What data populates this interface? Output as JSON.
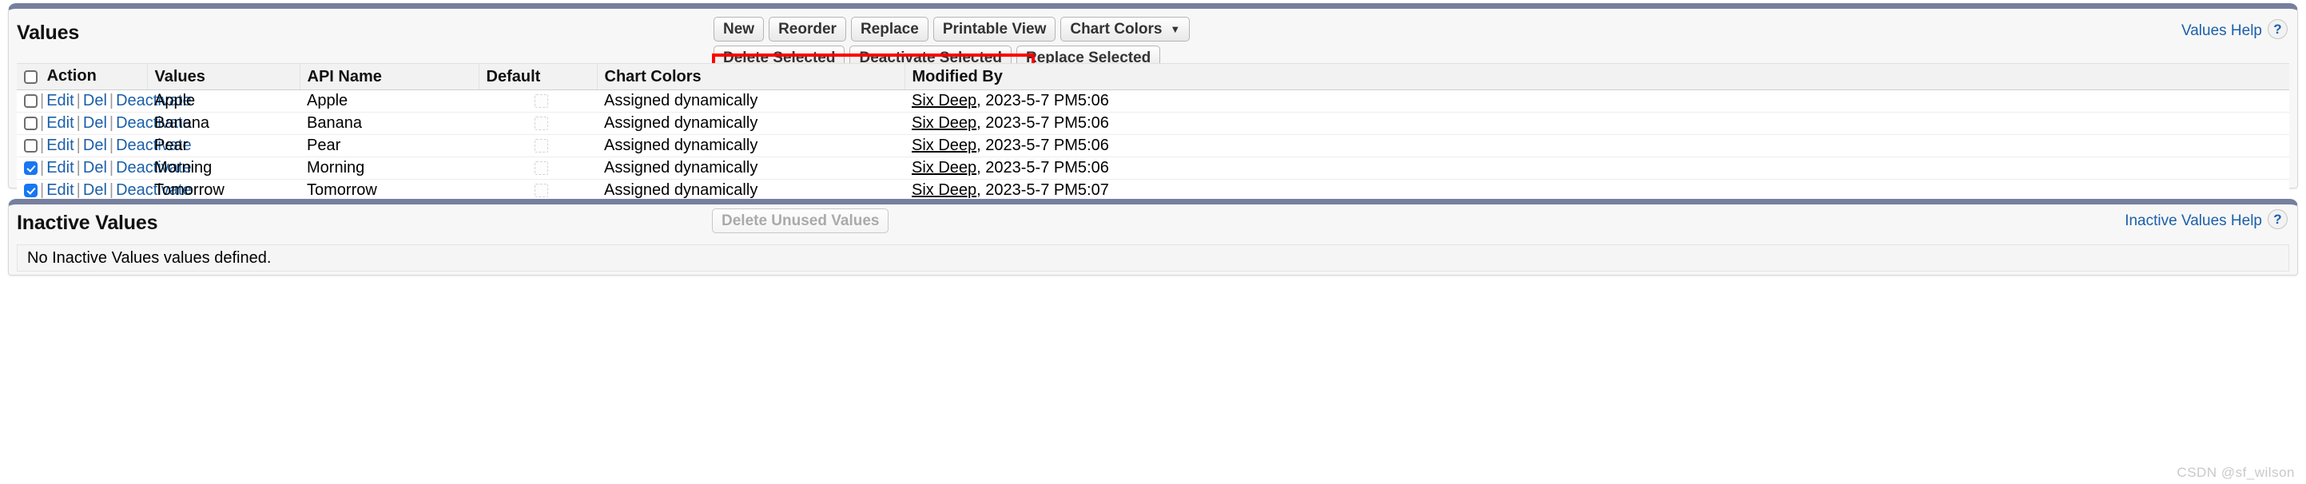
{
  "values_panel": {
    "title": "Values",
    "help_link": "Values Help",
    "help_icon": "?",
    "toolbar_row1": [
      {
        "label": "New",
        "name": "new-button",
        "disabled": false,
        "caret": false
      },
      {
        "label": "Reorder",
        "name": "reorder-button",
        "disabled": false,
        "caret": false
      },
      {
        "label": "Replace",
        "name": "replace-button",
        "disabled": false,
        "caret": false
      },
      {
        "label": "Printable View",
        "name": "printable-view-button",
        "disabled": false,
        "caret": false
      },
      {
        "label": "Chart Colors",
        "name": "chart-colors-dropdown",
        "disabled": false,
        "caret": true
      }
    ],
    "toolbar_row2": [
      {
        "label": "Delete Selected",
        "name": "delete-selected-button",
        "disabled": false,
        "caret": false
      },
      {
        "label": "Deactivate Selected",
        "name": "deactivate-selected-button",
        "disabled": false,
        "caret": false
      },
      {
        "label": "Replace Selected",
        "name": "replace-selected-button",
        "disabled": false,
        "caret": false
      }
    ],
    "caret_glyph": "▼",
    "highlight_color": "#ff0000",
    "columns": [
      "Action",
      "Values",
      "API Name",
      "Default",
      "Chart Colors",
      "Modified By"
    ],
    "row_actions": {
      "edit": "Edit",
      "del": "Del",
      "deactivate": "Deactivate",
      "separator": "|"
    },
    "rows": [
      {
        "selected": false,
        "value": "Apple",
        "api_name": "Apple",
        "default_checked": false,
        "chart_color": "Assigned dynamically",
        "modified_by_user": "Six Deep",
        "modified_at": ", 2023-5-7 PM5:06"
      },
      {
        "selected": false,
        "value": "Banana",
        "api_name": "Banana",
        "default_checked": false,
        "chart_color": "Assigned dynamically",
        "modified_by_user": "Six Deep",
        "modified_at": ", 2023-5-7 PM5:06"
      },
      {
        "selected": false,
        "value": "Pear",
        "api_name": "Pear",
        "default_checked": false,
        "chart_color": "Assigned dynamically",
        "modified_by_user": "Six Deep",
        "modified_at": ", 2023-5-7 PM5:06"
      },
      {
        "selected": true,
        "value": "Morning",
        "api_name": "Morning",
        "default_checked": false,
        "chart_color": "Assigned dynamically",
        "modified_by_user": "Six Deep",
        "modified_at": ", 2023-5-7 PM5:06"
      },
      {
        "selected": true,
        "value": "Tomorrow",
        "api_name": "Tomorrow",
        "default_checked": false,
        "chart_color": "Assigned dynamically",
        "modified_by_user": "Six Deep",
        "modified_at": ", 2023-5-7 PM5:07"
      }
    ]
  },
  "inactive_panel": {
    "title": "Inactive Values",
    "help_link": "Inactive Values Help",
    "help_icon": "?",
    "button": {
      "label": "Delete Unused Values",
      "name": "delete-unused-values-button",
      "disabled": true
    },
    "empty_message": "No Inactive Values values defined."
  },
  "watermark": "CSDN @sf_wilson"
}
